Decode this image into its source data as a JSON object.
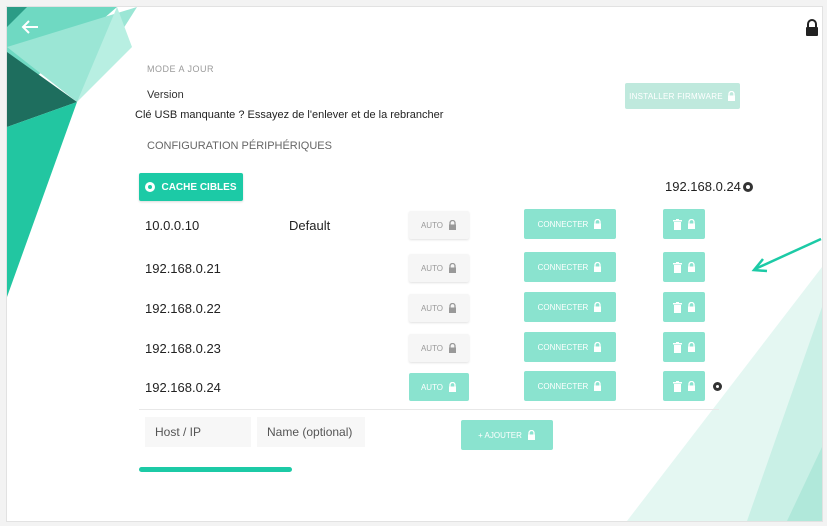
{
  "header": {
    "back_icon": "arrow-left-icon",
    "lock_icon": "lock-icon"
  },
  "settings": {
    "faded_label": "MODE A JOUR",
    "version_label": "Version",
    "install_firmware_label": "INSTALLER FIRMWARE",
    "usb_hint": "Clé USB manquante ? Essayez de l'enlever et de la rebrancher",
    "section_title": "CONFIGURATION PÉRIPHÉRIQUES"
  },
  "targets": {
    "cache_button_label": "CACHE CIBLES",
    "current_ip": "192.168.0.24"
  },
  "devices": [
    {
      "ip": "10.0.0.10",
      "name": "Default",
      "auto_label": "AUTO",
      "connect_label": "CONNECTER",
      "auto_active": false,
      "badge": false
    },
    {
      "ip": "192.168.0.21",
      "name": "",
      "auto_label": "AUTO",
      "connect_label": "CONNECTER",
      "auto_active": false,
      "badge": false
    },
    {
      "ip": "192.168.0.22",
      "name": "",
      "auto_label": "AUTO",
      "connect_label": "CONNECTER",
      "auto_active": false,
      "badge": false
    },
    {
      "ip": "192.168.0.23",
      "name": "",
      "auto_label": "AUTO",
      "connect_label": "CONNECTER",
      "auto_active": false,
      "badge": false
    },
    {
      "ip": "192.168.0.24",
      "name": "",
      "auto_label": "AUTO",
      "connect_label": "CONNECTER",
      "auto_active": true,
      "badge": true
    }
  ],
  "add_form": {
    "host_placeholder": "Host / IP",
    "name_placeholder": "Name (optional)",
    "add_label": "+ AJOUTER"
  },
  "colors": {
    "accent": "#1ccaa6",
    "accent_light": "#8ae3cf",
    "annotation_arrow": "#1ccaa6"
  }
}
